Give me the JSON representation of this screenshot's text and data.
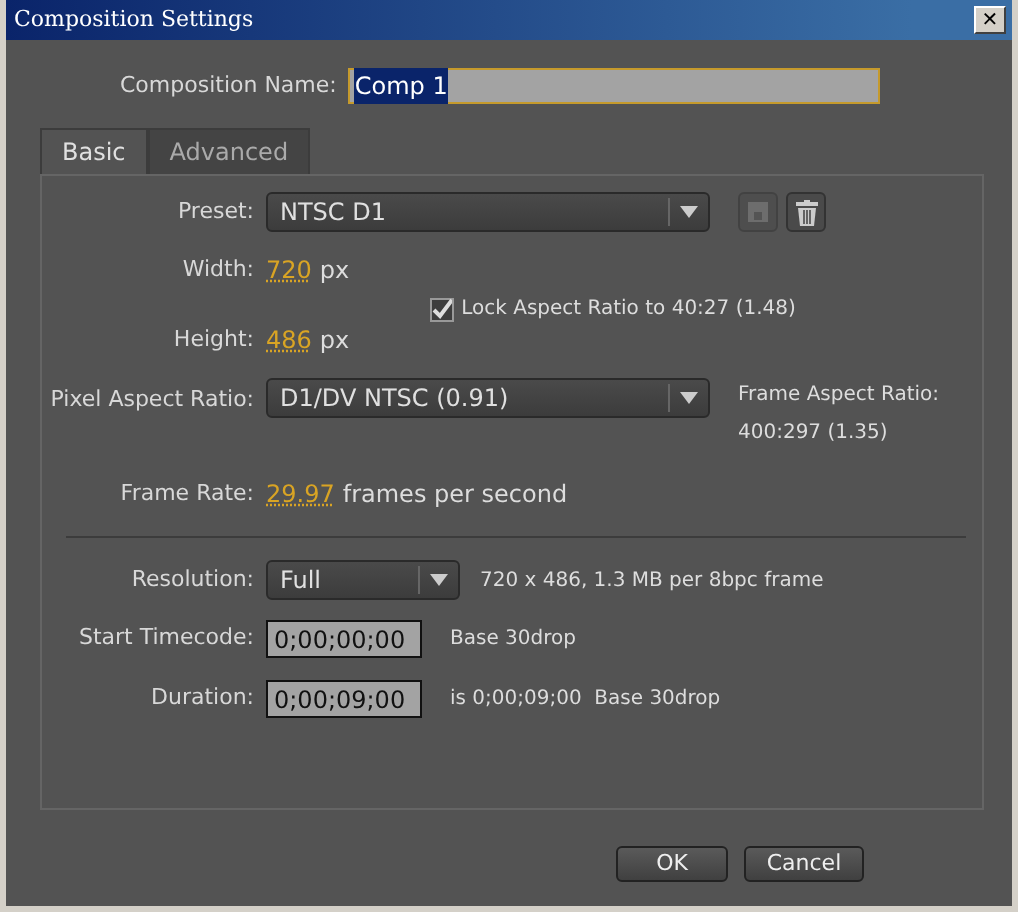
{
  "window": {
    "title": "Composition Settings",
    "close": "✕"
  },
  "composition_name": {
    "label": "Composition Name:",
    "value": "Comp 1",
    "text_selected": true
  },
  "tabs": [
    {
      "label": "Basic",
      "selected": true
    },
    {
      "label": "Advanced",
      "selected": false
    }
  ],
  "preset": {
    "label": "Preset:",
    "value": "NTSC D1",
    "save_disabled": true
  },
  "width": {
    "label": "Width:",
    "value": "720",
    "unit": "px"
  },
  "height": {
    "label": "Height:",
    "value": "486",
    "unit": "px"
  },
  "lock_aspect": {
    "label": "Lock Aspect Ratio to 40:27 (1.48)",
    "checked": true
  },
  "pixel_aspect": {
    "label": "Pixel Aspect Ratio:",
    "value": "D1/DV NTSC (0.91)"
  },
  "frame_aspect": {
    "label": "Frame Aspect Ratio:",
    "value": "400:297 (1.35)"
  },
  "frame_rate": {
    "label": "Frame Rate:",
    "value": "29.97",
    "unit": "frames per second"
  },
  "resolution": {
    "label": "Resolution:",
    "value": "Full",
    "info": "720 x 486, 1.3 MB per 8bpc frame"
  },
  "start_timecode": {
    "label": "Start Timecode:",
    "value": "0;00;00;00",
    "info": "Base 30drop"
  },
  "duration": {
    "label": "Duration:",
    "value": "0;00;09;00",
    "info": "is 0;00;09;00  Base 30drop"
  },
  "buttons": [
    {
      "label": "OK",
      "kind": "ok"
    },
    {
      "label": "Cancel",
      "kind": "cancel"
    }
  ]
}
